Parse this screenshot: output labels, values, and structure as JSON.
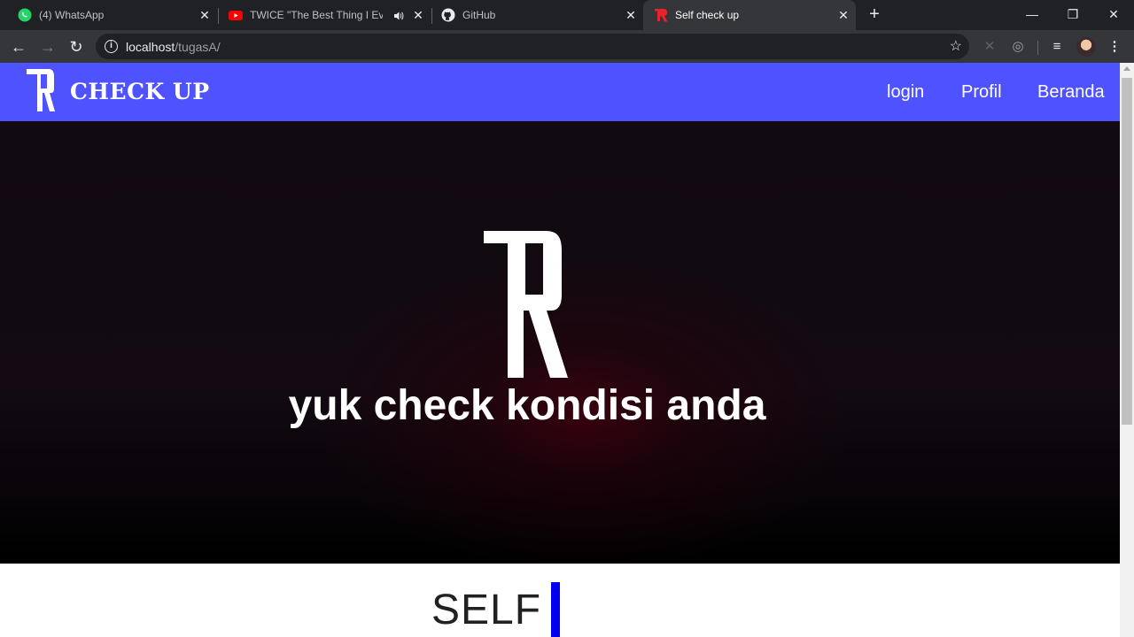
{
  "browser": {
    "tabs": [
      {
        "title": "(4) WhatsApp",
        "icon": "whatsapp-icon"
      },
      {
        "title": "TWICE \"The Best Thing I Ever Did\"",
        "icon": "youtube-icon",
        "audio": "speaker-icon"
      },
      {
        "title": "GitHub",
        "icon": "github-icon"
      },
      {
        "title": "Self check up",
        "icon": "site-logo-icon",
        "active": true
      }
    ],
    "url_host": "localhost",
    "url_path": "/tugasA/",
    "accent": "#4f52ff"
  },
  "site": {
    "brand_name": "CHECK UP",
    "nav": [
      {
        "label": "login"
      },
      {
        "label": "Profil"
      },
      {
        "label": "Beranda"
      }
    ],
    "hero_text": "yuk check kondisi anda",
    "section_title": "SELF"
  }
}
